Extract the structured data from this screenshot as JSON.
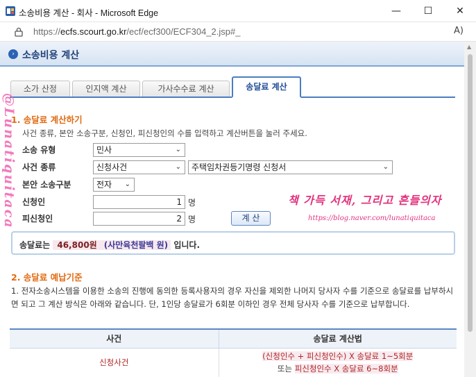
{
  "window": {
    "title": "소송비용 계산 - 회사 - Microsoft Edge",
    "minimize_glyph": "—",
    "maximize_glyph": "☐",
    "close_glyph": "✕"
  },
  "addressbar": {
    "url_scheme": "https://",
    "url_host": "ecfs.scourt.go.kr",
    "url_path": "/ecf/ecf300/ECF304_2.jsp#_",
    "read_aloud_glyph": "A)"
  },
  "page_header": {
    "title": "소송비용 계산",
    "icon_glyph": "›"
  },
  "tabs": [
    {
      "label": "소가 산정",
      "active": false
    },
    {
      "label": "인지액 계산",
      "active": false
    },
    {
      "label": "가사수수료 계산",
      "active": false
    },
    {
      "label": "송달료 계산",
      "active": true
    }
  ],
  "section1": {
    "title": "1. 송달료 계산하기",
    "description": "사건 종류, 본안 소송구분, 신청인, 피신청인의 수를 입력하고 계산버튼을 눌러 주세요.",
    "fields": {
      "case_type_label": "소송 유형",
      "case_type_value": "민사",
      "case_kind_label": "사건 종류",
      "case_kind_value": "신청사건",
      "case_kind_detail_value": "주택임차권등기명령 신청서",
      "main_suit_label": "본안 소송구분",
      "main_suit_value": "전자",
      "applicant_label": "신청인",
      "applicant_value": "1",
      "applicant_unit": "명",
      "respondent_label": "피신청인",
      "respondent_value": "2",
      "respondent_unit": "명"
    },
    "calc_button": "계 산",
    "result": {
      "prefix": "송달료는",
      "amount": "46,800원",
      "korean": "(사만육천팔백 원)",
      "suffix": "입니다."
    }
  },
  "section2": {
    "title": "2. 송달료 예납기준",
    "paragraph": "1. 전자소송시스템을 이용한 소송의 진행에 동의한 등록사용자의 경우 자신을 제외한 나머지 당사자 수를 기준으로 송달료를 납부하시면 되고 그 계산 방식은 아래와 같습니다. 단, 1인당 송달료가 6회분 이하인 경우 전체 당사자 수를 기준으로 납부합니다.",
    "table": {
      "headers": [
        "사건",
        "송달료 계산법"
      ],
      "rows": [
        {
          "case": "신청사건",
          "formula_line1": "(신청인수 + 피신청인수) X 송달료 1~5회분",
          "formula_line2_prefix": "또는",
          "formula_line2": "피신청인수 X 송달료 6~8회분"
        }
      ]
    }
  },
  "watermark": {
    "vertical": "@Lunatiquitaca",
    "handwriting": "책 가득 서재, 그리고 흔들의자",
    "blog_url": "https://blog.naver.com/lunatiquitaca"
  },
  "colors": {
    "accent_orange": "#e06b12",
    "tab_blue": "#4a7dc1",
    "header_blue": "#22427a",
    "watermark_pink": "#f26bb4"
  }
}
